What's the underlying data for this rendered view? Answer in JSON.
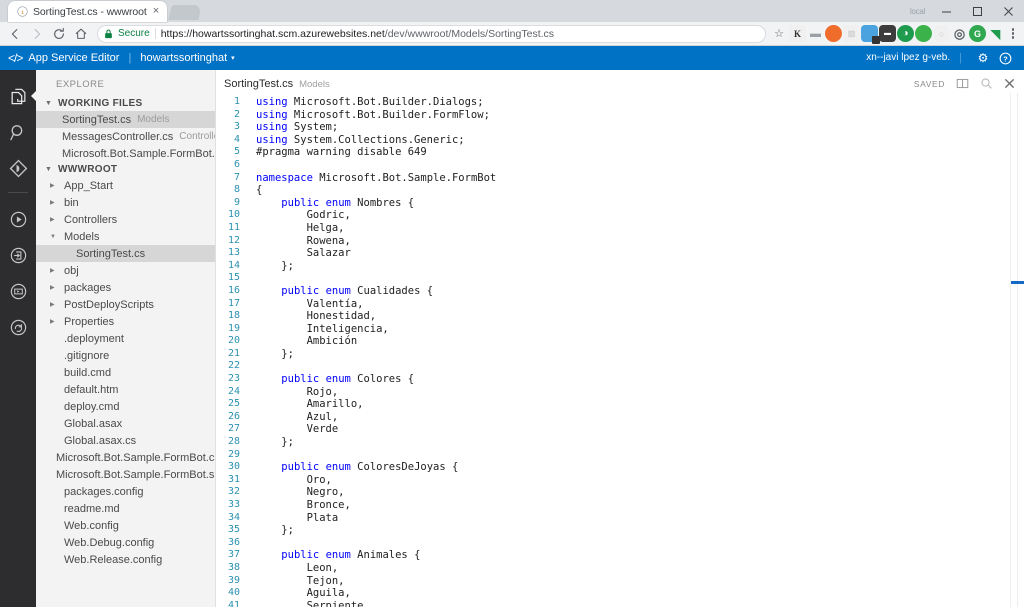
{
  "browser": {
    "tab": {
      "title": "SortingTest.cs - wwwroot",
      "favicon": "code-favicon",
      "close_label": "×"
    },
    "window_controls": {
      "minimize": "—",
      "maximize": "☐",
      "close": "✕",
      "brand": "local"
    },
    "nav": {
      "back": "←",
      "forward": "→",
      "reload": "↻",
      "home": "⌂"
    },
    "omnibox": {
      "secure_label": "Secure",
      "url_scheme": "https://",
      "url_host": "howartssortinghat.scm.azurewebsites.net",
      "url_path": "/dev/wwwroot/Models/SortingTest.cs",
      "url_full": "https://howartssortinghat.scm.azurewebsites.net/dev/wwwroot/Models/SortingTest.cs",
      "star": "☆"
    },
    "extensions": [
      {
        "name": "kindle-extension-icon",
        "glyph": "K",
        "bg": "#f0f0f0",
        "fg": "#333"
      },
      {
        "name": "speech-bubble-extension-icon",
        "glyph": "▬",
        "bg": "#f0f0f0",
        "fg": "#9aa0a6"
      },
      {
        "name": "orange-circle-extension-icon",
        "glyph": "●",
        "bg": "#ef6c2b",
        "fg": "#fff"
      },
      {
        "name": "chart-extension-icon",
        "glyph": "█",
        "bg": "#f0f0f0",
        "fg": "#d0d0d0"
      },
      {
        "name": "ghost-extension-icon",
        "glyph": "●",
        "bg": "#4aa3df",
        "fg": "#fff"
      },
      {
        "name": "mask-extension-icon",
        "glyph": "▬",
        "bg": "#3c3c3c",
        "fg": "#fff"
      },
      {
        "name": "green-ring-extension-icon",
        "glyph": "◐",
        "bg": "#1f9b4e",
        "fg": "#fff"
      },
      {
        "name": "green-dot-extension-icon",
        "glyph": "●",
        "bg": "#3cb24a",
        "fg": "#fff"
      },
      {
        "name": "grey-extension-icon",
        "glyph": "○",
        "bg": "#f0f0f0",
        "fg": "#c8c8c8"
      },
      {
        "name": "spiral-extension-icon",
        "glyph": "◎",
        "bg": "#f0f0f0",
        "fg": "#5f6368"
      },
      {
        "name": "grammarly-extension-icon",
        "glyph": "G",
        "bg": "#2fa84f",
        "fg": "#fff"
      },
      {
        "name": "cast-extension-icon",
        "glyph": "◢",
        "bg": "#1f9b4e",
        "fg": "#fff"
      }
    ]
  },
  "azure": {
    "logo": "</>",
    "product": "App Service Editor",
    "divider": "|",
    "site": "howartssortinghat",
    "caret": "▾",
    "user": "xn--javi lpez g-veb.",
    "vsep": "|",
    "settings_icon": "⚙",
    "help_icon": "?"
  },
  "activity_bar": [
    {
      "name": "explore-files-icon",
      "active": true
    },
    {
      "name": "search-icon",
      "active": false
    },
    {
      "name": "source-control-icon",
      "active": false
    },
    {
      "name": "run-icon",
      "active": false
    },
    {
      "name": "open-site-icon",
      "active": false
    },
    {
      "name": "console-icon",
      "active": false
    },
    {
      "name": "restart-icon",
      "active": false
    }
  ],
  "sidebar": {
    "explore_label": "EXPLORE",
    "working_files": {
      "label": "WORKING FILES",
      "twisty": "▼",
      "items": [
        {
          "name": "SortingTest.cs",
          "sub": "Models",
          "selected": true
        },
        {
          "name": "MessagesController.cs",
          "sub": "Controllers",
          "selected": false
        },
        {
          "name": "Microsoft.Bot.Sample.FormBot.cspr...",
          "sub": "",
          "selected": false
        }
      ]
    },
    "wwwroot": {
      "label": "WWWROOT",
      "twisty": "▼",
      "tree": [
        {
          "label": "App_Start",
          "type": "folder",
          "expanded": false,
          "depth": 1
        },
        {
          "label": "bin",
          "type": "folder",
          "expanded": false,
          "depth": 1
        },
        {
          "label": "Controllers",
          "type": "folder",
          "expanded": false,
          "depth": 1
        },
        {
          "label": "Models",
          "type": "folder",
          "expanded": true,
          "depth": 1
        },
        {
          "label": "SortingTest.cs",
          "type": "file",
          "expanded": false,
          "depth": 2,
          "selected": true
        },
        {
          "label": "obj",
          "type": "folder",
          "expanded": false,
          "depth": 1
        },
        {
          "label": "packages",
          "type": "folder",
          "expanded": false,
          "depth": 1
        },
        {
          "label": "PostDeployScripts",
          "type": "folder",
          "expanded": false,
          "depth": 1
        },
        {
          "label": "Properties",
          "type": "folder",
          "expanded": false,
          "depth": 1
        },
        {
          "label": ".deployment",
          "type": "file",
          "expanded": false,
          "depth": 1
        },
        {
          "label": ".gitignore",
          "type": "file",
          "expanded": false,
          "depth": 1
        },
        {
          "label": "build.cmd",
          "type": "file",
          "expanded": false,
          "depth": 1
        },
        {
          "label": "default.htm",
          "type": "file",
          "expanded": false,
          "depth": 1
        },
        {
          "label": "deploy.cmd",
          "type": "file",
          "expanded": false,
          "depth": 1
        },
        {
          "label": "Global.asax",
          "type": "file",
          "expanded": false,
          "depth": 1
        },
        {
          "label": "Global.asax.cs",
          "type": "file",
          "expanded": false,
          "depth": 1
        },
        {
          "label": "Microsoft.Bot.Sample.FormBot.csproj",
          "type": "file",
          "expanded": false,
          "depth": 1
        },
        {
          "label": "Microsoft.Bot.Sample.FormBot.sln",
          "type": "file",
          "expanded": false,
          "depth": 1
        },
        {
          "label": "packages.config",
          "type": "file",
          "expanded": false,
          "depth": 1
        },
        {
          "label": "readme.md",
          "type": "file",
          "expanded": false,
          "depth": 1
        },
        {
          "label": "Web.config",
          "type": "file",
          "expanded": false,
          "depth": 1
        },
        {
          "label": "Web.Debug.config",
          "type": "file",
          "expanded": false,
          "depth": 1
        },
        {
          "label": "Web.Release.config",
          "type": "file",
          "expanded": false,
          "depth": 1
        }
      ]
    }
  },
  "editor": {
    "tab_name": "SortingTest.cs",
    "tab_sub": "Models",
    "status": "SAVED",
    "split_icon": "◫",
    "preview_icon": "⌕",
    "close_icon": "✕",
    "first_line": 1,
    "lines": [
      {
        "n": 1,
        "text": "using Microsoft.Bot.Builder.Dialogs;",
        "kw": "using"
      },
      {
        "n": 2,
        "text": "using Microsoft.Bot.Builder.FormFlow;",
        "kw": "using"
      },
      {
        "n": 3,
        "text": "using System;",
        "kw": "using"
      },
      {
        "n": 4,
        "text": "using System.Collections.Generic;",
        "kw": "using"
      },
      {
        "n": 5,
        "text": "#pragma warning disable 649",
        "kw": ""
      },
      {
        "n": 6,
        "text": "",
        "kw": ""
      },
      {
        "n": 7,
        "text": "namespace Microsoft.Bot.Sample.FormBot",
        "kw": "namespace"
      },
      {
        "n": 8,
        "text": "{",
        "kw": ""
      },
      {
        "n": 9,
        "text": "    public enum Nombres {",
        "kw": "public enum"
      },
      {
        "n": 10,
        "text": "        Godric,",
        "kw": ""
      },
      {
        "n": 11,
        "text": "        Helga,",
        "kw": ""
      },
      {
        "n": 12,
        "text": "        Rowena,",
        "kw": ""
      },
      {
        "n": 13,
        "text": "        Salazar",
        "kw": ""
      },
      {
        "n": 14,
        "text": "    };",
        "kw": ""
      },
      {
        "n": 15,
        "text": "",
        "kw": ""
      },
      {
        "n": 16,
        "text": "    public enum Cualidades {",
        "kw": "public enum"
      },
      {
        "n": 17,
        "text": "        Valentía,",
        "kw": ""
      },
      {
        "n": 18,
        "text": "        Honestidad,",
        "kw": ""
      },
      {
        "n": 19,
        "text": "        Inteligencia,",
        "kw": ""
      },
      {
        "n": 20,
        "text": "        Ambición",
        "kw": ""
      },
      {
        "n": 21,
        "text": "    };",
        "kw": ""
      },
      {
        "n": 22,
        "text": "",
        "kw": ""
      },
      {
        "n": 23,
        "text": "    public enum Colores {",
        "kw": "public enum"
      },
      {
        "n": 24,
        "text": "        Rojo,",
        "kw": ""
      },
      {
        "n": 25,
        "text": "        Amarillo,",
        "kw": ""
      },
      {
        "n": 26,
        "text": "        Azul,",
        "kw": ""
      },
      {
        "n": 27,
        "text": "        Verde",
        "kw": ""
      },
      {
        "n": 28,
        "text": "    };",
        "kw": ""
      },
      {
        "n": 29,
        "text": "",
        "kw": ""
      },
      {
        "n": 30,
        "text": "    public enum ColoresDeJoyas {",
        "kw": "public enum"
      },
      {
        "n": 31,
        "text": "        Oro,",
        "kw": ""
      },
      {
        "n": 32,
        "text": "        Negro,",
        "kw": ""
      },
      {
        "n": 33,
        "text": "        Bronce,",
        "kw": ""
      },
      {
        "n": 34,
        "text": "        Plata",
        "kw": ""
      },
      {
        "n": 35,
        "text": "    };",
        "kw": ""
      },
      {
        "n": 36,
        "text": "",
        "kw": ""
      },
      {
        "n": 37,
        "text": "    public enum Animales {",
        "kw": "public enum"
      },
      {
        "n": 38,
        "text": "        Leon,",
        "kw": ""
      },
      {
        "n": 39,
        "text": "        Tejon,",
        "kw": ""
      },
      {
        "n": 40,
        "text": "        Aguila,",
        "kw": ""
      },
      {
        "n": 41,
        "text": "        Serpiente",
        "kw": ""
      }
    ]
  },
  "colors": {
    "azure_blue": "#0072c6",
    "activity_bar": "#2d2d30",
    "sidebar_bg": "#f3f3f3",
    "selection": "#d6d6d6",
    "keyword": "#0000ff",
    "line_number": "#2b91af",
    "cursor_marker": "#1469c7"
  }
}
